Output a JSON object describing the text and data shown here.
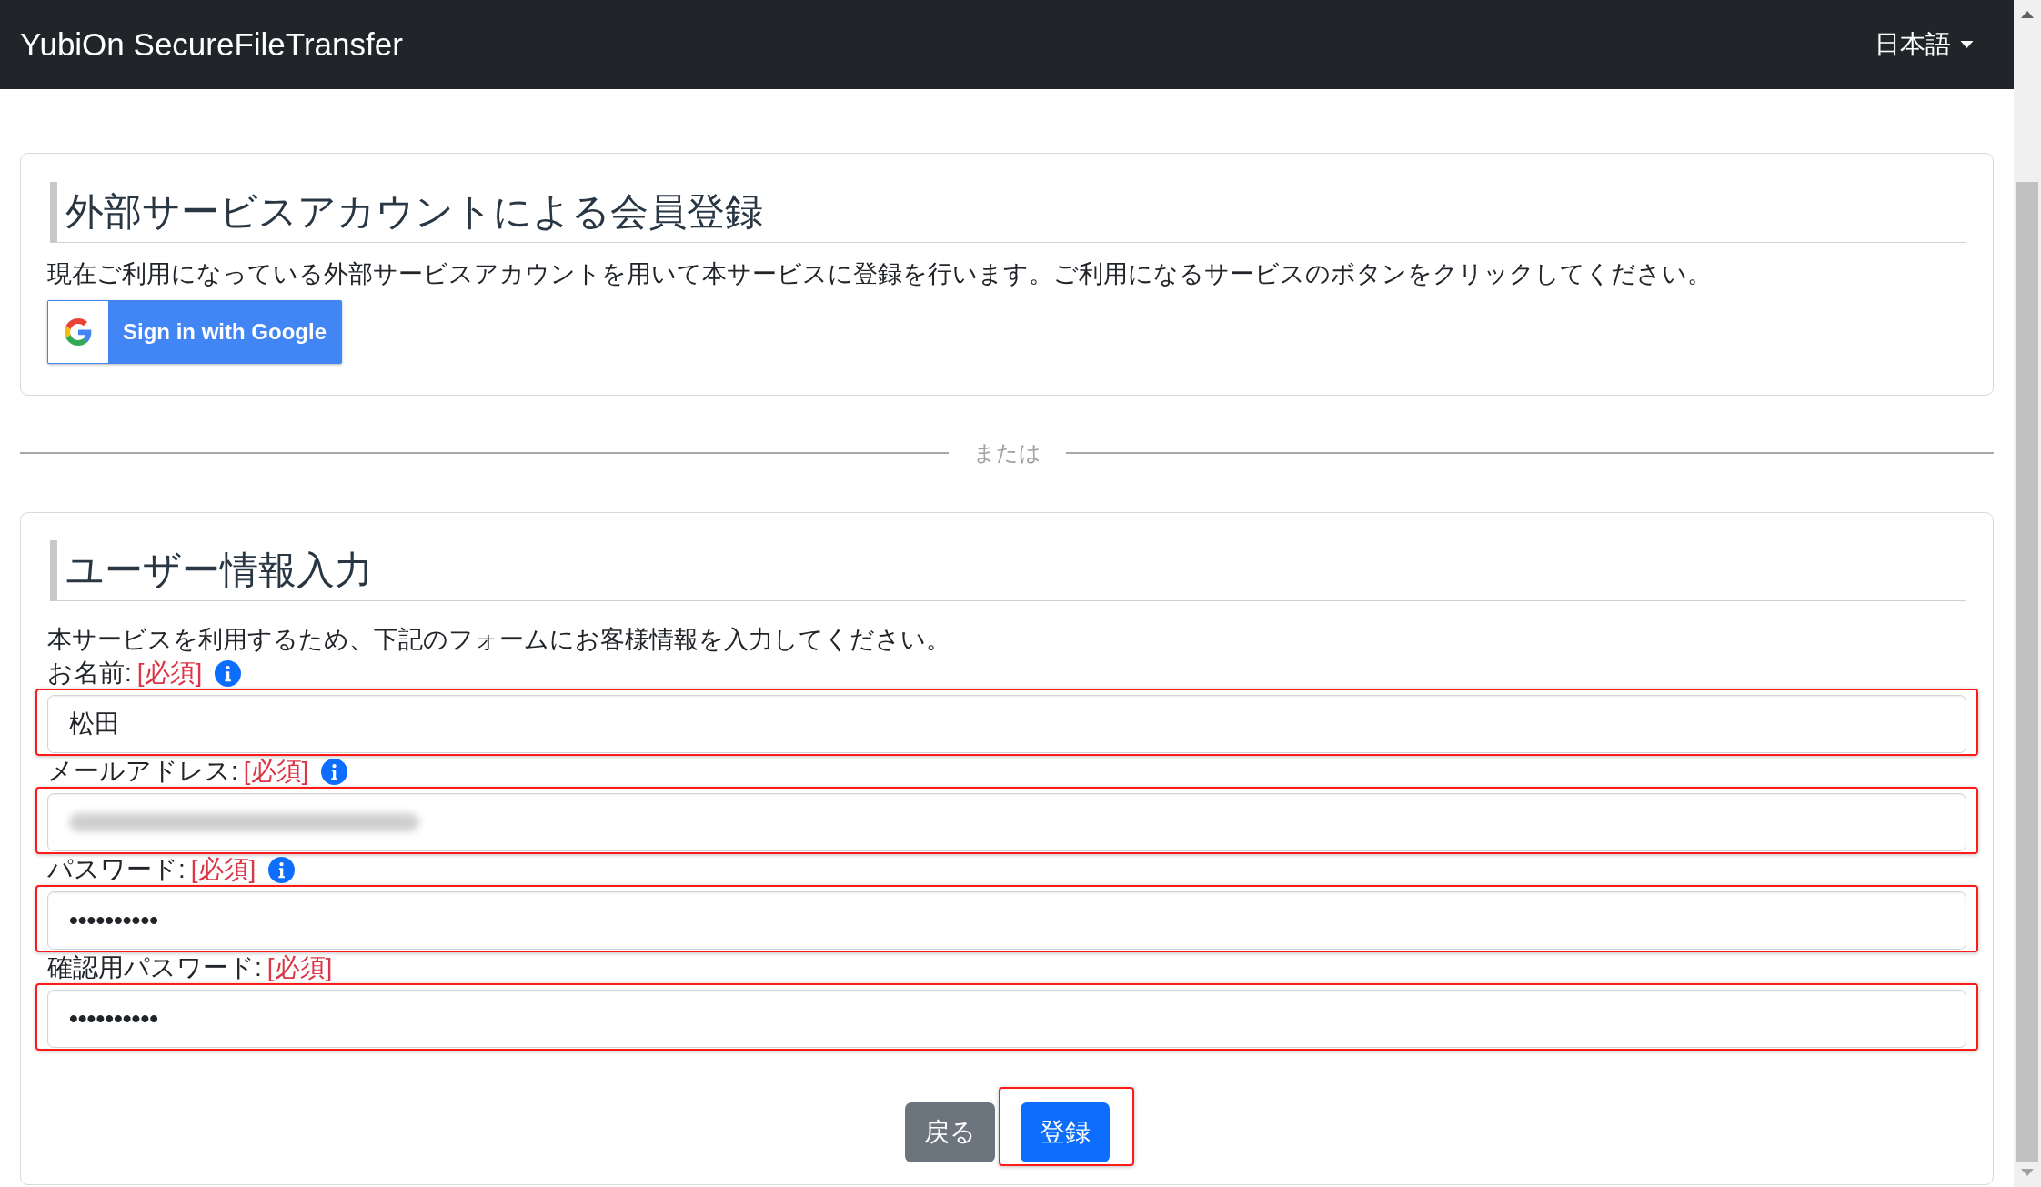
{
  "navbar": {
    "brand": "YubiOn SecureFileTransfer",
    "language": "日本語"
  },
  "external_signup": {
    "title": "外部サービスアカウントによる会員登録",
    "description": "現在ご利用になっている外部サービスアカウントを用いて本サービスに登録を行います。ご利用になるサービスのボタンをクリックしてください。",
    "google_button": "Sign in with Google"
  },
  "divider": "または",
  "user_info": {
    "title": "ユーザー情報入力",
    "description": "本サービスを利用するため、下記のフォームにお客様情報を入力してください。",
    "fields": [
      {
        "kind": "text",
        "label": "お名前:",
        "required_mark": "[必須]",
        "info": true,
        "value": "松田",
        "highlighted": true
      },
      {
        "kind": "email",
        "label": "メールアドレス:",
        "required_mark": "[必須]",
        "info": true,
        "redacted": true,
        "highlighted": true
      },
      {
        "kind": "password",
        "label": "パスワード:",
        "required_mark": "[必須]",
        "info": true,
        "value": "••••••••••",
        "highlighted": true
      },
      {
        "kind": "password",
        "label": "確認用パスワード:",
        "required_mark": "[必須]",
        "info": false,
        "value": "••••••••••",
        "highlighted": true
      }
    ],
    "buttons": [
      {
        "kind": "back",
        "label": "戻る",
        "highlighted": false
      },
      {
        "kind": "submit",
        "label": "登録",
        "highlighted": true
      }
    ]
  }
}
